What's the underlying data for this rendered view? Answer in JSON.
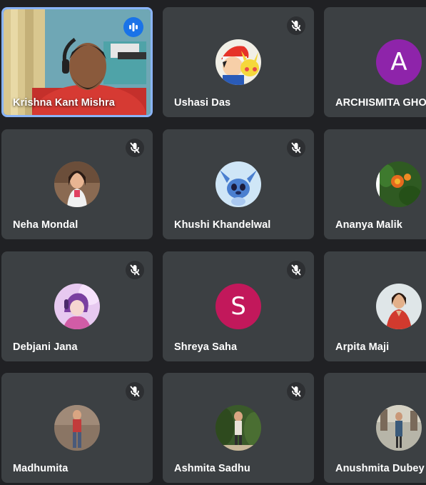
{
  "participants": [
    {
      "name": "Krishna Kant Mishra",
      "muted": false,
      "speaking": true,
      "avatar": "video-feed"
    },
    {
      "name": "Ushasi Das",
      "muted": true,
      "avatar": "cartoon-photo"
    },
    {
      "name": "ARCHISMITA GHO",
      "muted": false,
      "avatar_letter": "A",
      "avatar_color": "#8e24aa"
    },
    {
      "name": "Neha Mondal",
      "muted": true,
      "avatar": "photo"
    },
    {
      "name": "Khushi Khandelwal",
      "muted": true,
      "avatar": "cartoon-photo"
    },
    {
      "name": "Ananya Malik",
      "muted": false,
      "avatar": "flower-photo"
    },
    {
      "name": "Debjani Jana",
      "muted": true,
      "avatar": "anime-photo"
    },
    {
      "name": "Shreya Saha",
      "muted": true,
      "avatar_letter": "S",
      "avatar_color": "#c2185b"
    },
    {
      "name": "Arpita Maji",
      "muted": false,
      "avatar": "photo"
    },
    {
      "name": "Madhumita",
      "muted": true,
      "avatar": "photo"
    },
    {
      "name": "Ashmita Sadhu",
      "muted": true,
      "avatar": "photo"
    },
    {
      "name": "Anushmita Dubey",
      "muted": false,
      "avatar": "photo"
    }
  ],
  "colors": {
    "background": "#202124",
    "tile": "#3c4043",
    "active_border": "#8ab4f8",
    "speaking_badge": "#1a73e8"
  },
  "icons": {
    "mute": "mic-off-icon",
    "speaking": "audio-level-icon"
  }
}
